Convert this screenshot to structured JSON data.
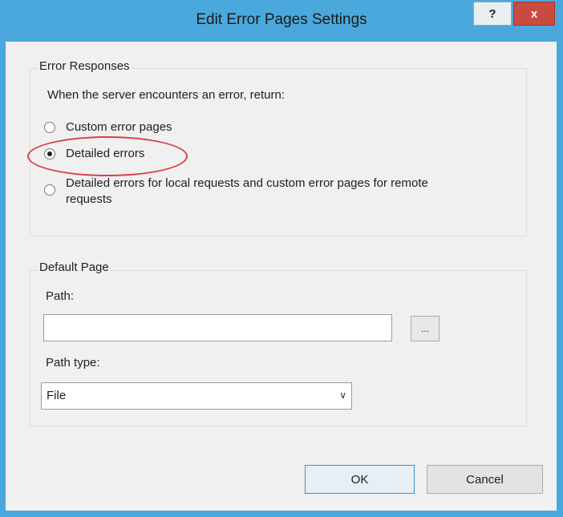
{
  "window": {
    "title": "Edit Error Pages Settings",
    "help_label": "?",
    "close_label": "x"
  },
  "error_responses": {
    "group_label": "Error Responses",
    "prompt": "When the server encounters an error, return:",
    "options": [
      {
        "label": "Custom error pages",
        "selected": false
      },
      {
        "label": "Detailed errors",
        "selected": true
      },
      {
        "label": "Detailed errors for local requests and custom error pages for remote requests",
        "selected": false
      }
    ]
  },
  "default_page": {
    "group_label": "Default Page",
    "path_label": "Path:",
    "path_value": "",
    "browse_label": "...",
    "path_type_label": "Path type:",
    "path_type_value": "File"
  },
  "buttons": {
    "ok": "OK",
    "cancel": "Cancel"
  },
  "colors": {
    "title_bar": "#4ba8dc",
    "close_button": "#c94a3f",
    "highlight_circle": "#d8404a"
  }
}
